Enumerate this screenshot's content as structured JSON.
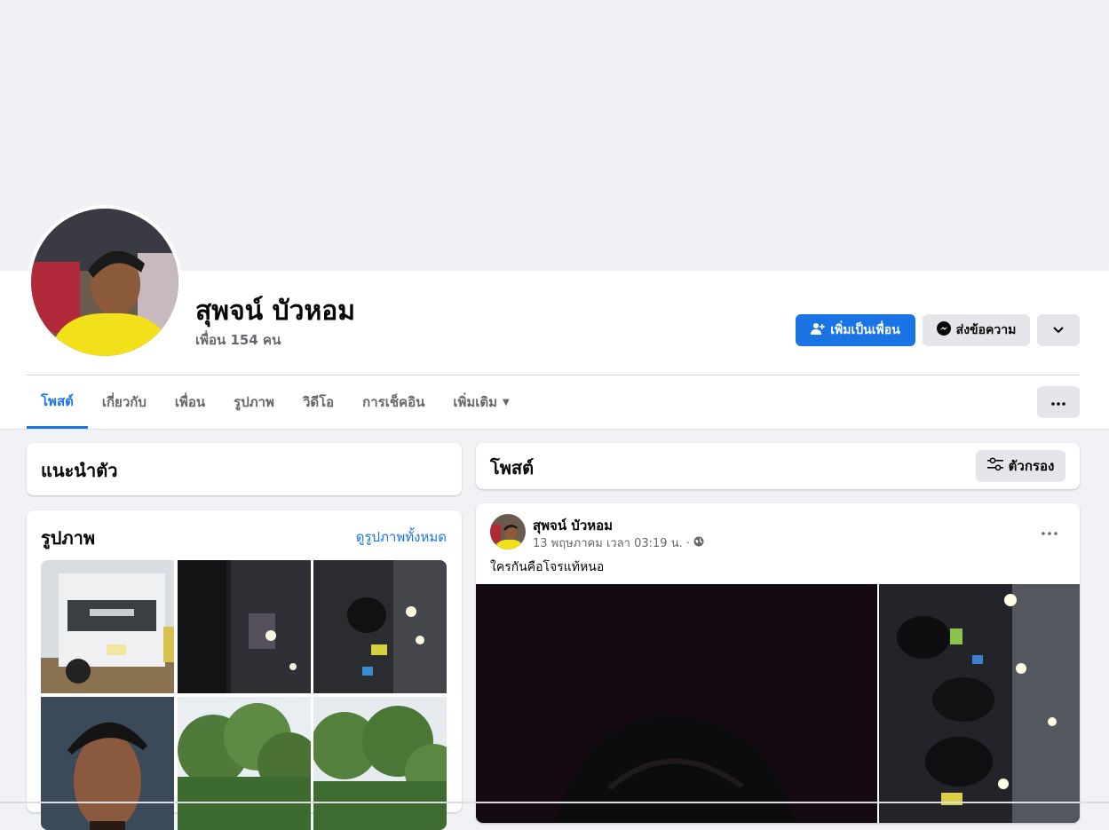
{
  "profile": {
    "name": "สุพจน์ บัวหอม",
    "friends": "เพื่อน 154 คน"
  },
  "actions": {
    "add_friend": "เพิ่มเป็นเพื่อน",
    "message": "ส่งข้อความ"
  },
  "tabs": [
    {
      "label": "โพสต์",
      "active": true
    },
    {
      "label": "เกี่ยวกับ",
      "active": false
    },
    {
      "label": "เพื่อน",
      "active": false
    },
    {
      "label": "รูปภาพ",
      "active": false
    },
    {
      "label": "วิดีโอ",
      "active": false
    },
    {
      "label": "การเช็คอิน",
      "active": false
    },
    {
      "label": "เพิ่มเติม",
      "active": false
    }
  ],
  "intro": {
    "title": "แนะนำตัว"
  },
  "photos": {
    "title": "รูปภาพ",
    "see_all": "ดูรูปภาพทั้งหมด"
  },
  "posts_section": {
    "title": "โพสต์",
    "filter": "ตัวกรอง"
  },
  "post": {
    "author": "สุพจน์ บัวหอม",
    "timestamp": "13 พฤษภาคม เวลา 03:19 น. ·",
    "text": "ใครกันคือโจรแท้หนอ"
  },
  "colors": {
    "accent": "#1b74e4",
    "background": "#f0f2f5",
    "secondary_text": "#65676b"
  }
}
